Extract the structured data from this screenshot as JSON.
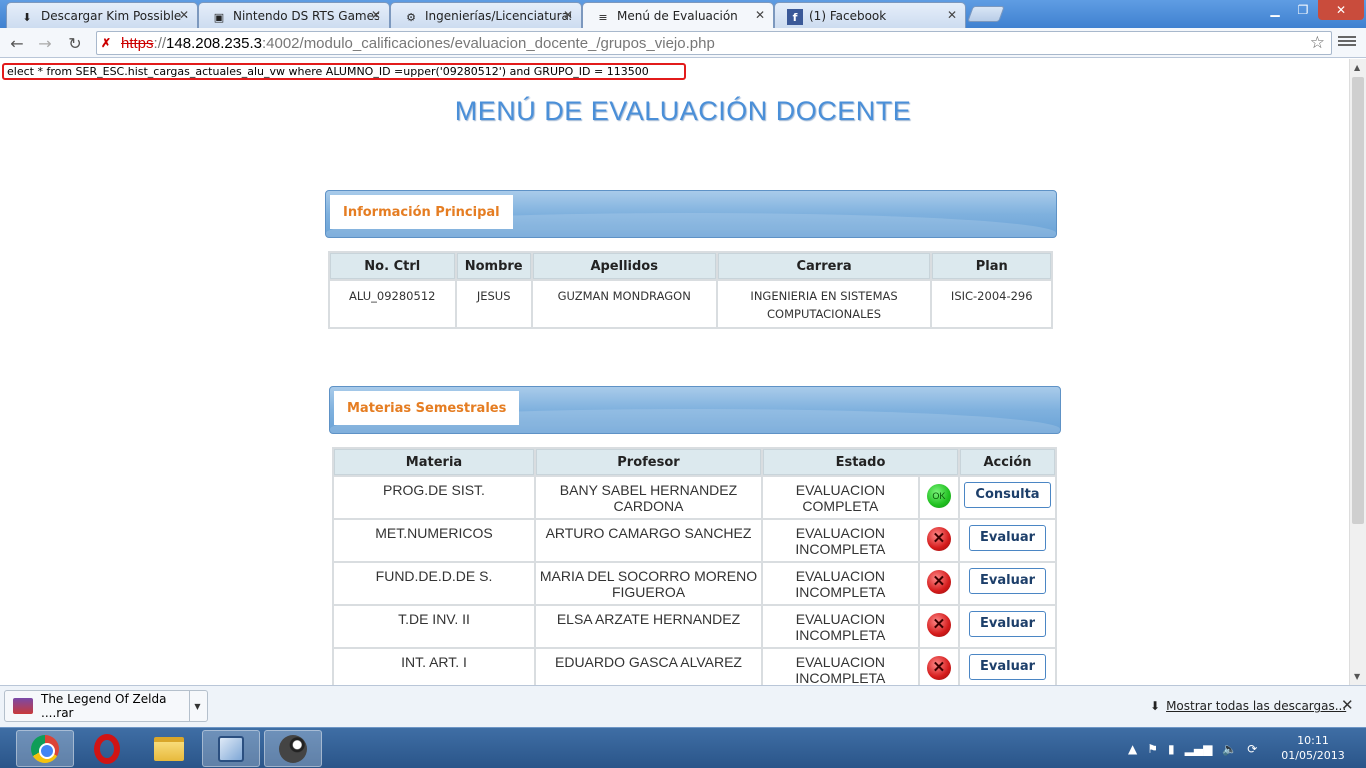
{
  "browser": {
    "tabs": [
      {
        "title": "Descargar Kim Possible - ",
        "icon": "download-site-favicon"
      },
      {
        "title": "Nintendo DS RTS Games - ",
        "icon": "nds-favicon"
      },
      {
        "title": "Ingenierías/Licenciaturas",
        "icon": "gear-favicon"
      },
      {
        "title": "Menú de Evaluación",
        "icon": "ittol-favicon"
      },
      {
        "title": "(1) Facebook",
        "icon": "facebook-favicon"
      }
    ],
    "active_tab": 3,
    "url": {
      "scheme": "https",
      "host": "148.208.235.3",
      "path": ":4002/modulo_calificaciones/evaluacion_docente_/grupos_viejo.php"
    },
    "tab_close_symbol": "✕",
    "fb_letter": "f"
  },
  "page": {
    "sql_debug": "elect * from SER_ESC.hist_cargas_actuales_alu_vw where ALUMNO_ID =upper('09280512') and GRUPO_ID = 113500",
    "title": "MENÚ DE EVALUACIÓN DOCENTE",
    "info_section": {
      "label": "Información Principal",
      "headers": [
        "No. Ctrl",
        "Nombre",
        "Apellidos",
        "Carrera",
        "Plan"
      ],
      "row": {
        "no_ctrl": "ALU_09280512",
        "nombre": "JESUS",
        "apellidos": "GUZMAN MONDRAGON",
        "carrera": "INGENIERIA EN SISTEMAS COMPUTACIONALES",
        "plan": "ISIC-2004-296"
      }
    },
    "materias_section": {
      "label": "Materias Semestrales",
      "headers": [
        "Materia",
        "Profesor",
        "Estado",
        "Acción"
      ],
      "rows": [
        {
          "materia": "PROG.DE SIST.",
          "profesor": "BANY SABEL HERNANDEZ CARDONA",
          "estado": "EVALUACION COMPLETA",
          "status": "ok",
          "status_text": "OK",
          "accion": "Consulta"
        },
        {
          "materia": "MET.NUMERICOS",
          "profesor": "ARTURO CAMARGO SANCHEZ",
          "estado": "EVALUACION INCOMPLETA",
          "status": "bad",
          "status_text": "✕",
          "accion": "Evaluar"
        },
        {
          "materia": "FUND.DE.D.DE S.",
          "profesor": "MARIA DEL SOCORRO MORENO FIGUEROA",
          "estado": "EVALUACION INCOMPLETA",
          "status": "bad",
          "status_text": "✕",
          "accion": "Evaluar"
        },
        {
          "materia": "T.DE INV. II",
          "profesor": "ELSA ARZATE HERNANDEZ",
          "estado": "EVALUACION INCOMPLETA",
          "status": "bad",
          "status_text": "✕",
          "accion": "Evaluar"
        },
        {
          "materia": "INT. ART. I",
          "profesor": "EDUARDO GASCA ALVAREZ",
          "estado": "EVALUACION INCOMPLETA",
          "status": "bad",
          "status_text": "✕",
          "accion": "Evaluar"
        }
      ]
    }
  },
  "download_shelf": {
    "item_name": "The Legend Of Zelda ....rar",
    "show_all": "Mostrar todas las descargas...",
    "close_symbol": "✕"
  },
  "taskbar": {
    "apps": [
      "chrome",
      "opera",
      "file-explorer",
      "virtualbox",
      "steam"
    ],
    "time": "10:11",
    "date": "01/05/2013"
  },
  "colors": {
    "title_blue": "#4a8fd8",
    "section_label_orange": "#e57d22",
    "sql_highlight_red": "#e21b1b"
  }
}
